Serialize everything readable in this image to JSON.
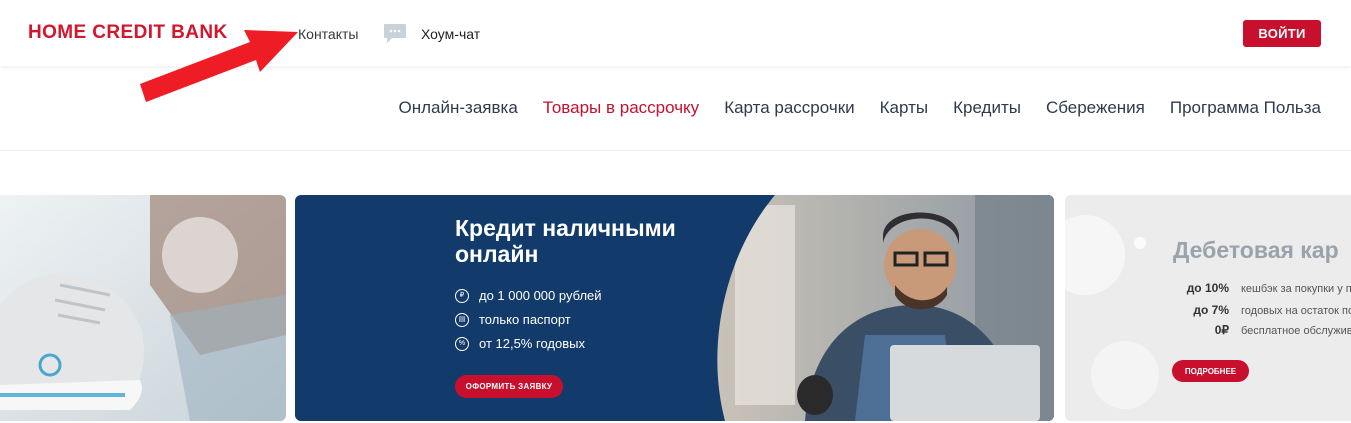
{
  "header": {
    "logo_text": "HOME CREDIT BANK",
    "contacts_label": "Контакты",
    "chat_label": "Хоум-чат",
    "login_label": "ВОЙТИ"
  },
  "nav": {
    "items": [
      {
        "label": "Онлайн-заявка"
      },
      {
        "label": "Товары в рассрочку"
      },
      {
        "label": "Карта рассрочки"
      },
      {
        "label": "Карты"
      },
      {
        "label": "Кредиты"
      },
      {
        "label": "Сбережения"
      },
      {
        "label": "Программа Польза"
      }
    ],
    "active_index": 1
  },
  "slides": {
    "center": {
      "title": "Кредит наличными онлайн",
      "features": [
        {
          "icon": "ruble-icon",
          "symbol": "₽",
          "text": "до 1 000 000 рублей"
        },
        {
          "icon": "passport-icon",
          "symbol": "▤",
          "text": "только паспорт"
        },
        {
          "icon": "percent-icon",
          "symbol": "%",
          "text": "от 12,5% годовых"
        }
      ],
      "button_label": "ОФОРМИТЬ ЗАЯВКУ"
    },
    "right": {
      "title": "Дебетовая кар",
      "rows": [
        {
          "value": "до 10%",
          "text": "кешбэк за покупки у п"
        },
        {
          "value": "до 7%",
          "text": "годовых на остаток по"
        },
        {
          "value": "0₽",
          "text": "бесплатное обслужива"
        }
      ],
      "button_label": "ПОДРОБНЕЕ"
    }
  },
  "colors": {
    "brand_red": "#c8102e",
    "navy": "#123b6c",
    "nav_text": "#2f3b4c"
  }
}
